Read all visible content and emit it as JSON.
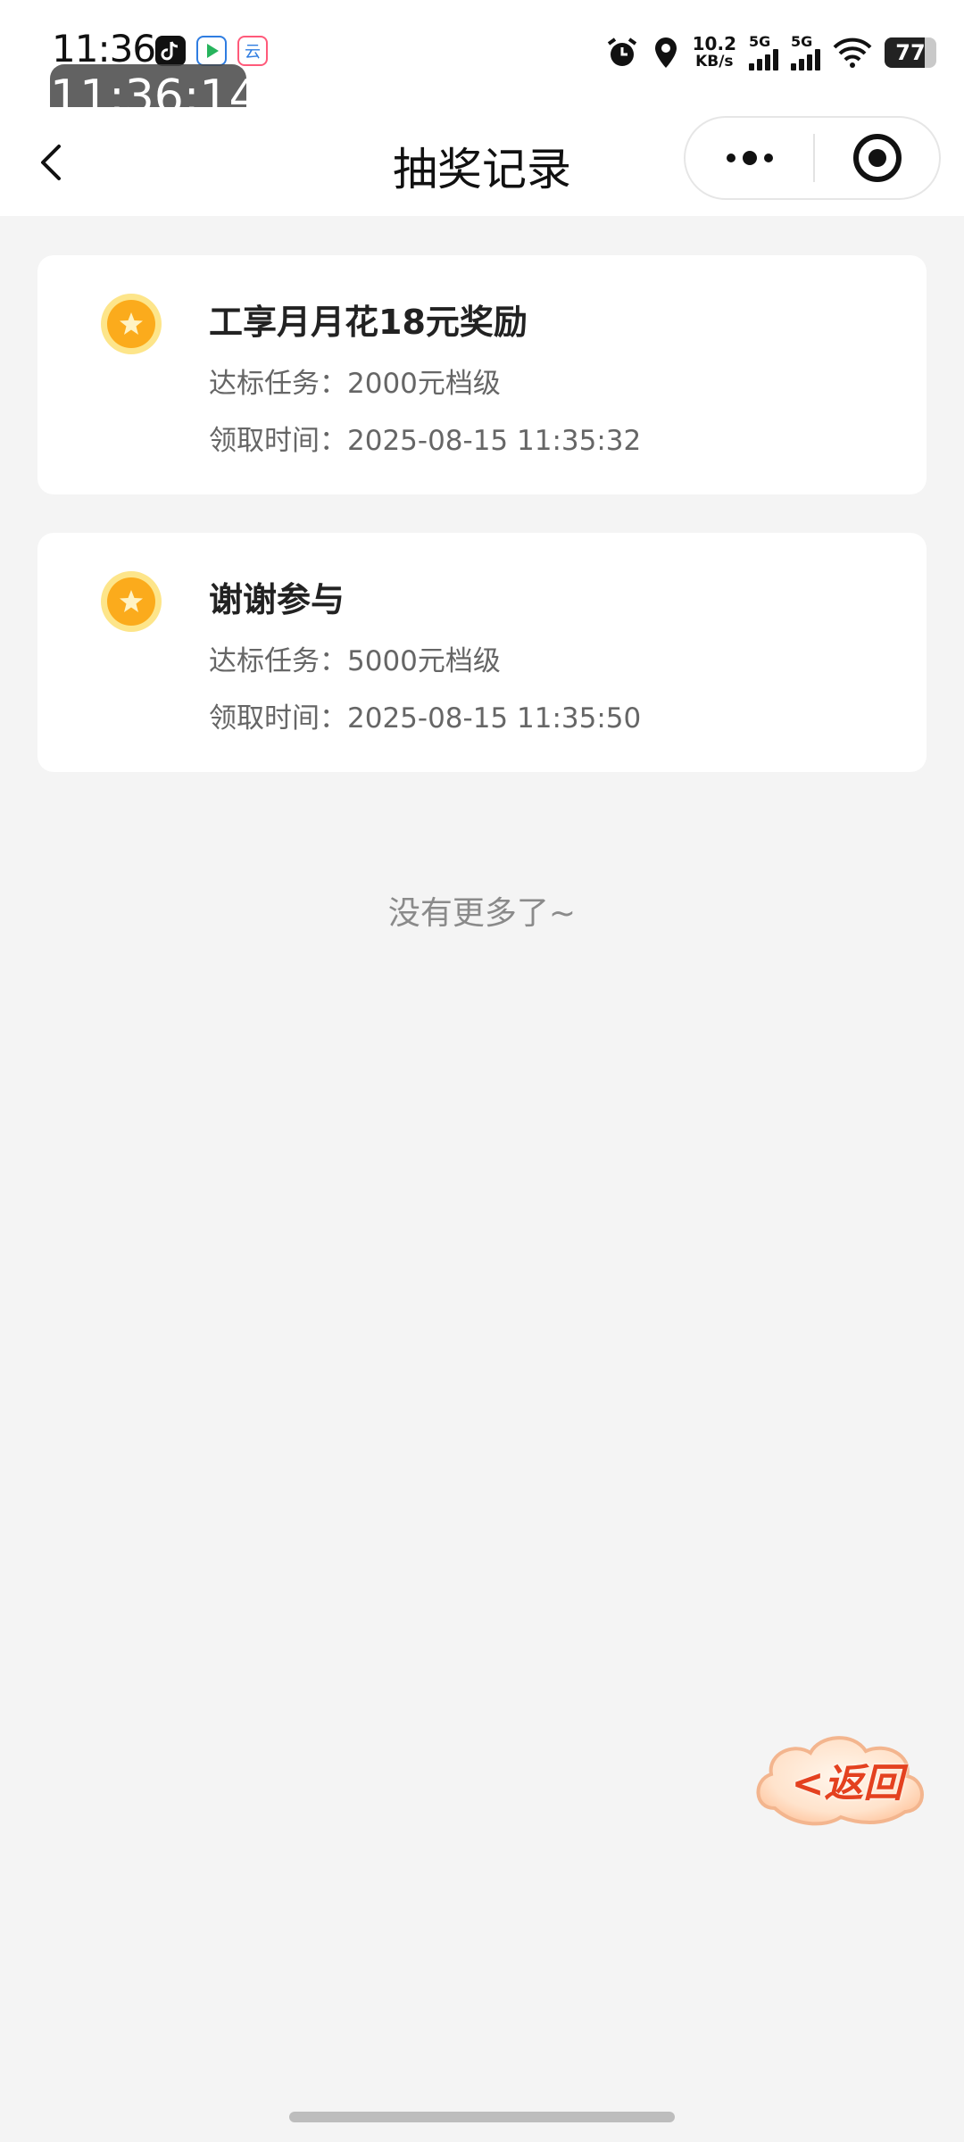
{
  "status_bar": {
    "time": "11:36",
    "net_speed_value": "10.2",
    "net_speed_unit": "KB/s",
    "signal1_label": "5G",
    "signal2_label": "5G",
    "battery_level": "77",
    "battery_fraction": 0.77,
    "app_icons": [
      "tiktok-icon",
      "video-app-icon",
      "cloud-app-icon"
    ]
  },
  "floating_clock": {
    "time": "11:36:14"
  },
  "nav": {
    "title": "抽奖记录",
    "back_icon": "chevron-left-icon",
    "more_icon": "more-dots-icon",
    "close_icon": "target-close-icon"
  },
  "records": [
    {
      "title": "工享月月花18元奖励",
      "task_label": "达标任务：",
      "task_value": "2000元档级",
      "time_label": "领取时间：",
      "time_value": "2025-08-15 11:35:32",
      "icon": "gold-coin-star-icon"
    },
    {
      "title": "谢谢参与",
      "task_label": "达标任务：",
      "task_value": "5000元档级",
      "time_label": "领取时间：",
      "time_value": "2025-08-15 11:35:50",
      "icon": "gold-coin-star-icon"
    }
  ],
  "footer": {
    "no_more_text": "没有更多了~"
  },
  "return_button": {
    "label": "<返回"
  },
  "colors": {
    "background": "#f4f4f4",
    "card": "#ffffff",
    "coin_outer": "#fde58a",
    "coin_inner": "#fbab1c",
    "return_text": "#e4411f",
    "muted_text": "#666666"
  }
}
